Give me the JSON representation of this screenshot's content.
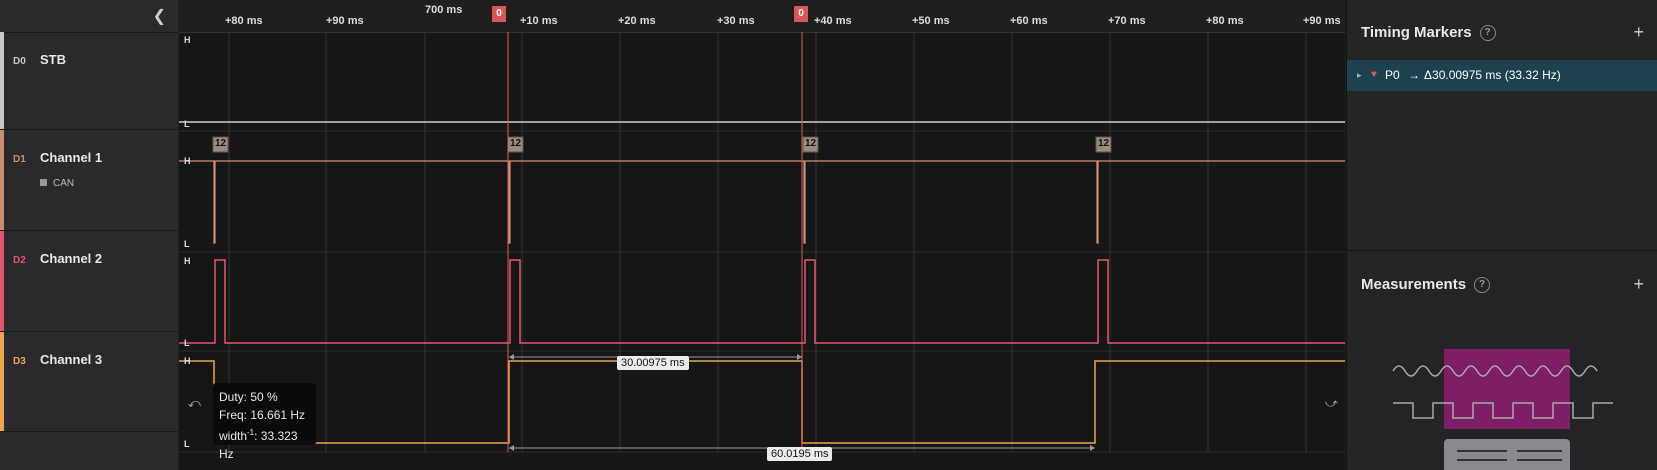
{
  "sidebar": {
    "collapse_icon": "chevron-left-icon",
    "channels": [
      {
        "id": "D0",
        "name": "STB",
        "color": "#c8c8c8"
      },
      {
        "id": "D1",
        "name": "Channel 1",
        "color": "#c98f6c",
        "protocol": "CAN"
      },
      {
        "id": "D2",
        "name": "Channel 2",
        "color": "#e5566b"
      },
      {
        "id": "D3",
        "name": "Channel 3",
        "color": "#e9a94a"
      }
    ]
  },
  "ruler": {
    "ticks": [
      "+80 ms",
      "+90 ms",
      "700 ms",
      "+10 ms",
      "+20 ms",
      "+30 ms",
      "+40 ms",
      "+50 ms",
      "+60 ms",
      "+70 ms",
      "+80 ms",
      "+90 ms"
    ],
    "marker_label": "0"
  },
  "levels": {
    "high": "H",
    "low": "L"
  },
  "decoder_badge": "12",
  "tooltip": {
    "duty": "Duty: 50 %",
    "freq": "Freq: 16.661 Hz",
    "width_prefix": "width",
    "width_sup": "-1",
    "width_value": ": 33.323 Hz"
  },
  "measurements_on_wave": {
    "interval_1": "30.00975 ms",
    "interval_2": "60.0195 ms"
  },
  "right_panel": {
    "timing_markers_title": "Timing Markers",
    "timing_marker_row": {
      "name": "P0",
      "arrow": "→",
      "delta": "Δ30.00975 ms (33.32 Hz)"
    },
    "measurements_title": "Measurements",
    "help_glyph": "?",
    "add_glyph": "+"
  }
}
